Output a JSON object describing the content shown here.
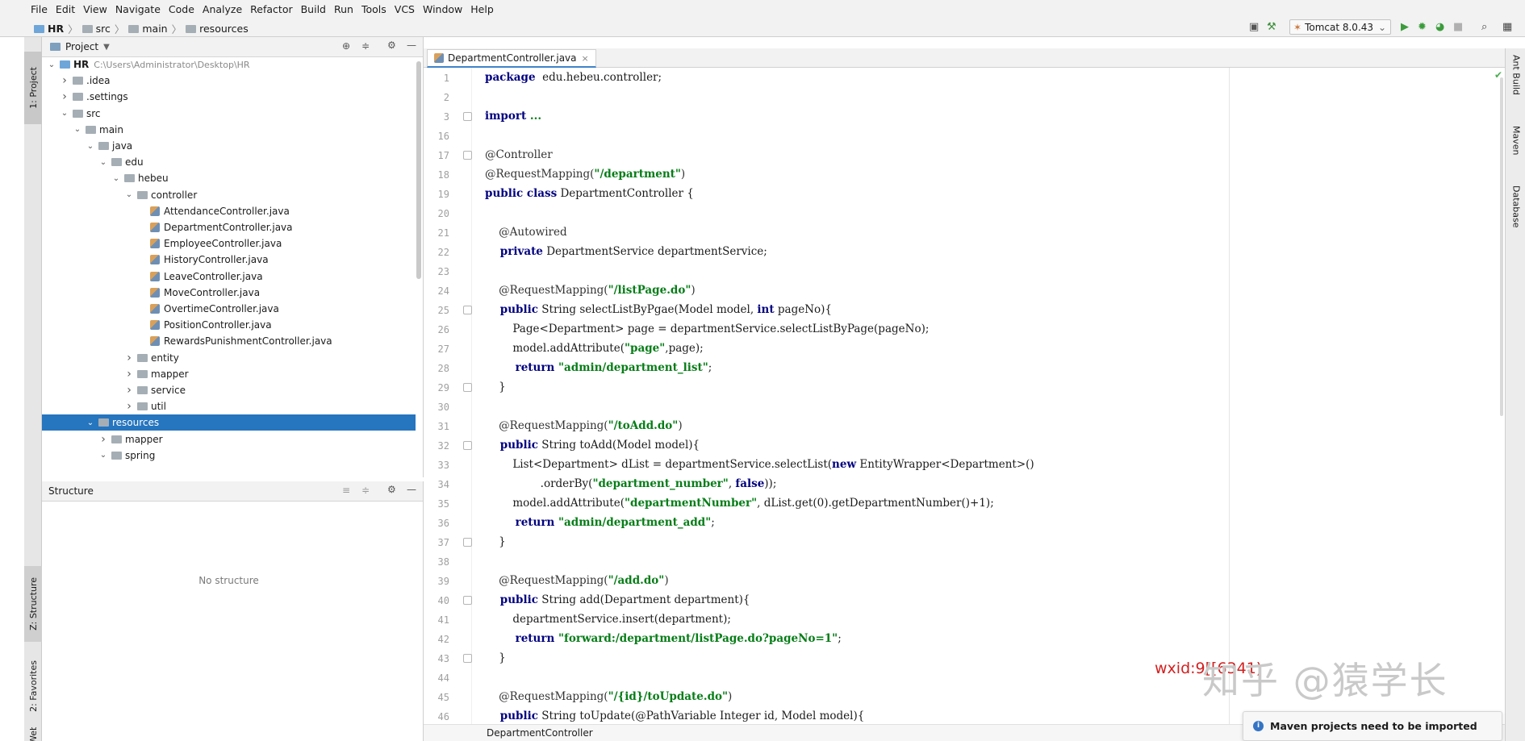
{
  "menu": [
    "File",
    "Edit",
    "View",
    "Navigate",
    "Code",
    "Analyze",
    "Refactor",
    "Build",
    "Run",
    "Tools",
    "VCS",
    "Window",
    "Help"
  ],
  "breadcrumb": [
    "HR",
    "src",
    "main",
    "resources"
  ],
  "toolbar": {
    "run_config": "Tomcat 8.0.43",
    "icons": [
      "layout-icon",
      "hammer-icon",
      "run-icon",
      "debug-icon",
      "coverage-icon",
      "stop-icon",
      "search-icon",
      "project-structure-icon"
    ]
  },
  "left_tabs": [
    "1: Project",
    "Z: Structure",
    "2: Favorites",
    "Web"
  ],
  "project_panel": {
    "title": "Project",
    "tree": [
      {
        "depth": 0,
        "chev": "open",
        "kind": "folder-blue",
        "label": "HR",
        "hint": "C:\\Users\\Administrator\\Desktop\\HR"
      },
      {
        "depth": 1,
        "chev": "closed",
        "kind": "folder",
        "label": ".idea"
      },
      {
        "depth": 1,
        "chev": "closed",
        "kind": "folder",
        "label": ".settings"
      },
      {
        "depth": 1,
        "chev": "open",
        "kind": "folder",
        "label": "src"
      },
      {
        "depth": 2,
        "chev": "open",
        "kind": "folder",
        "label": "main"
      },
      {
        "depth": 3,
        "chev": "open",
        "kind": "folder",
        "label": "java"
      },
      {
        "depth": 4,
        "chev": "open",
        "kind": "folder",
        "label": "edu"
      },
      {
        "depth": 5,
        "chev": "open",
        "kind": "folder",
        "label": "hebeu"
      },
      {
        "depth": 6,
        "chev": "open",
        "kind": "folder",
        "label": "controller"
      },
      {
        "depth": 7,
        "chev": "none",
        "kind": "java",
        "label": "AttendanceController.java"
      },
      {
        "depth": 7,
        "chev": "none",
        "kind": "java",
        "label": "DepartmentController.java"
      },
      {
        "depth": 7,
        "chev": "none",
        "kind": "java",
        "label": "EmployeeController.java"
      },
      {
        "depth": 7,
        "chev": "none",
        "kind": "java",
        "label": "HistoryController.java"
      },
      {
        "depth": 7,
        "chev": "none",
        "kind": "java",
        "label": "LeaveController.java"
      },
      {
        "depth": 7,
        "chev": "none",
        "kind": "java",
        "label": "MoveController.java"
      },
      {
        "depth": 7,
        "chev": "none",
        "kind": "java",
        "label": "OvertimeController.java"
      },
      {
        "depth": 7,
        "chev": "none",
        "kind": "java",
        "label": "PositionController.java"
      },
      {
        "depth": 7,
        "chev": "none",
        "kind": "java",
        "label": "RewardsPunishmentController.java"
      },
      {
        "depth": 6,
        "chev": "closed",
        "kind": "folder",
        "label": "entity"
      },
      {
        "depth": 6,
        "chev": "closed",
        "kind": "folder",
        "label": "mapper"
      },
      {
        "depth": 6,
        "chev": "closed",
        "kind": "folder",
        "label": "service"
      },
      {
        "depth": 6,
        "chev": "closed",
        "kind": "folder",
        "label": "util"
      },
      {
        "depth": 3,
        "chev": "open",
        "kind": "folder",
        "label": "resources",
        "selected": true
      },
      {
        "depth": 4,
        "chev": "closed",
        "kind": "folder",
        "label": "mapper"
      },
      {
        "depth": 4,
        "chev": "open",
        "kind": "folder",
        "label": "spring"
      }
    ]
  },
  "structure_panel": {
    "title": "Structure",
    "empty_text": "No structure"
  },
  "editor": {
    "tab_label": "DepartmentController.java",
    "breadcrumb": "DepartmentController",
    "lines": [
      {
        "n": "1",
        "t": [
          [
            "kw",
            "package"
          ],
          [
            "",
            "  edu.hebeu.controller;"
          ]
        ]
      },
      {
        "n": "2",
        "t": []
      },
      {
        "n": "3",
        "t": [
          [
            "kw",
            "import"
          ],
          [
            "st",
            " ..."
          ]
        ]
      },
      {
        "n": "16",
        "t": []
      },
      {
        "n": "17",
        "t": [
          [
            "an",
            "@Controller"
          ]
        ]
      },
      {
        "n": "18",
        "t": [
          [
            "an",
            "@RequestMapping("
          ],
          [
            "st",
            "\"/department\""
          ],
          [
            "an",
            ")"
          ]
        ]
      },
      {
        "n": "19",
        "t": [
          [
            "kw",
            "public class"
          ],
          [
            "",
            " DepartmentController {"
          ]
        ]
      },
      {
        "n": "20",
        "t": []
      },
      {
        "n": "21",
        "t": [
          [
            "an",
            "    @Autowired"
          ]
        ]
      },
      {
        "n": "22",
        "t": [
          [
            "kw",
            "    private"
          ],
          [
            "",
            " DepartmentService departmentService;"
          ]
        ]
      },
      {
        "n": "23",
        "t": []
      },
      {
        "n": "24",
        "t": [
          [
            "an",
            "    @RequestMapping("
          ],
          [
            "st",
            "\"/listPage.do\""
          ],
          [
            "an",
            ")"
          ]
        ]
      },
      {
        "n": "25",
        "t": [
          [
            "kw",
            "    public"
          ],
          [
            "",
            " String selectListByPgae(Model model, "
          ],
          [
            "kw",
            "int"
          ],
          [
            "",
            " pageNo){"
          ]
        ]
      },
      {
        "n": "26",
        "t": [
          [
            "",
            "        Page<Department> page = departmentService.selectListByPage(pageNo);"
          ]
        ]
      },
      {
        "n": "27",
        "t": [
          [
            "",
            "        model.addAttribute("
          ],
          [
            "st",
            "\"page\""
          ],
          [
            "",
            ",page);"
          ]
        ]
      },
      {
        "n": "28",
        "t": [
          [
            "kw",
            "        return"
          ],
          [
            "st",
            " \"admin/department_list\""
          ],
          [
            "",
            ";"
          ]
        ]
      },
      {
        "n": "29",
        "t": [
          [
            "",
            "    }"
          ]
        ]
      },
      {
        "n": "30",
        "t": []
      },
      {
        "n": "31",
        "t": [
          [
            "an",
            "    @RequestMapping("
          ],
          [
            "st",
            "\"/toAdd.do\""
          ],
          [
            "an",
            ")"
          ]
        ]
      },
      {
        "n": "32",
        "t": [
          [
            "kw",
            "    public"
          ],
          [
            "",
            " String toAdd(Model model){"
          ]
        ]
      },
      {
        "n": "33",
        "t": [
          [
            "",
            "        List<Department> dList = departmentService.selectList("
          ],
          [
            "kw",
            "new"
          ],
          [
            "",
            " EntityWrapper<Department>()"
          ]
        ]
      },
      {
        "n": "34",
        "t": [
          [
            "",
            "                .orderBy("
          ],
          [
            "st",
            "\"department_number\""
          ],
          [
            "",
            ", "
          ],
          [
            "kw",
            "false"
          ],
          [
            "",
            "));"
          ]
        ]
      },
      {
        "n": "35",
        "t": [
          [
            "",
            "        model.addAttribute("
          ],
          [
            "st",
            "\"departmentNumber\""
          ],
          [
            "",
            ", dList.get(0).getDepartmentNumber()+1);"
          ]
        ]
      },
      {
        "n": "36",
        "t": [
          [
            "kw",
            "        return"
          ],
          [
            "st",
            " \"admin/department_add\""
          ],
          [
            "",
            ";"
          ]
        ]
      },
      {
        "n": "37",
        "t": [
          [
            "",
            "    }"
          ]
        ]
      },
      {
        "n": "38",
        "t": []
      },
      {
        "n": "39",
        "t": [
          [
            "an",
            "    @RequestMapping("
          ],
          [
            "st",
            "\"/add.do\""
          ],
          [
            "an",
            ")"
          ]
        ]
      },
      {
        "n": "40",
        "t": [
          [
            "kw",
            "    public"
          ],
          [
            "",
            " String add(Department department){"
          ]
        ]
      },
      {
        "n": "41",
        "t": [
          [
            "",
            "        departmentService.insert(department);"
          ]
        ]
      },
      {
        "n": "42",
        "t": [
          [
            "kw",
            "        return"
          ],
          [
            "st",
            " \"forward:/department/listPage.do?pageNo=1\""
          ],
          [
            "",
            ";"
          ]
        ]
      },
      {
        "n": "43",
        "t": [
          [
            "",
            "    }"
          ]
        ]
      },
      {
        "n": "44",
        "t": []
      },
      {
        "n": "45",
        "t": [
          [
            "an",
            "    @RequestMapping("
          ],
          [
            "st",
            "\"/{id}/toUpdate.do\""
          ],
          [
            "an",
            ")"
          ]
        ]
      },
      {
        "n": "46",
        "t": [
          [
            "kw",
            "    public"
          ],
          [
            "",
            " String toUpdate(@PathVariable Integer id, Model model){"
          ]
        ]
      }
    ]
  },
  "right_tabs": [
    "Ant Build",
    "Maven",
    "Database"
  ],
  "notification": "Maven projects need to be imported",
  "watermark": {
    "wxid": "wxid:9[[6341)",
    "brand": "知乎 @猿学长"
  }
}
